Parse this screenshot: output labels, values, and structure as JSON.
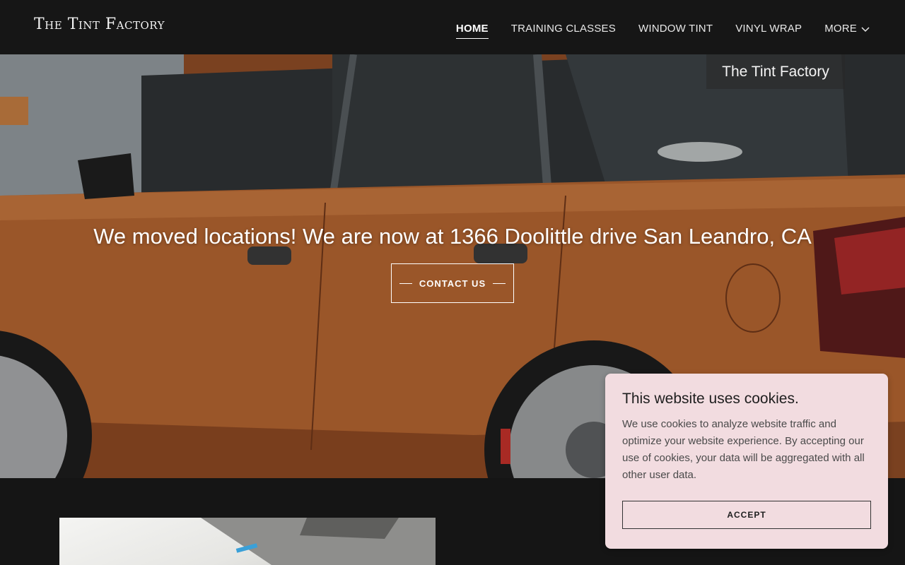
{
  "header": {
    "logo": "The Tint Factory",
    "nav": [
      {
        "label": "HOME",
        "active": true
      },
      {
        "label": "TRAINING CLASSES"
      },
      {
        "label": "WINDOW TINT"
      },
      {
        "label": "VINYL WRAP"
      },
      {
        "label": "MORE"
      }
    ],
    "more_icon": "chevron-down-icon"
  },
  "hero": {
    "badge": "The Tint Factory",
    "headline": "We moved locations! We are now at 1366 Doolittle drive San Leandro, CA",
    "cta_label": "CONTACT US"
  },
  "cookie": {
    "title": "This website uses cookies.",
    "text": "We use cookies to analyze website traffic and optimize your website experience. By accepting our use of cookies, your data will be aggregated with all other user data.",
    "accept_label": "ACCEPT"
  },
  "colors": {
    "header_bg": "#161616",
    "cookie_bg": "#f2dce0",
    "car_paint": "#b0622f"
  }
}
